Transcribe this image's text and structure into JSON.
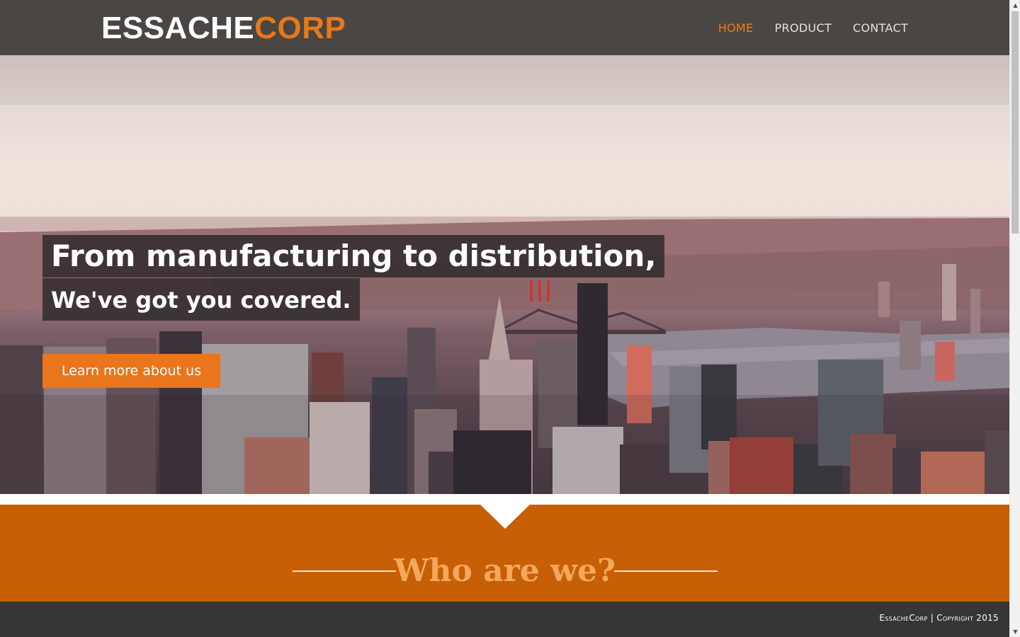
{
  "header": {
    "logo": {
      "part1": "ESSACHE",
      "part2": "CORP"
    },
    "nav": [
      {
        "label": "HOME",
        "active": true
      },
      {
        "label": "PRODUCT",
        "active": false
      },
      {
        "label": "CONTACT",
        "active": false
      }
    ]
  },
  "hero": {
    "headline": "From manufacturing to distribution,",
    "subheadline": "We've got you covered.",
    "cta_label": "Learn more about us"
  },
  "about": {
    "title": "Who are we?"
  },
  "footer": {
    "copyright": "EssacheCorp | Copyright 2015"
  },
  "colors": {
    "header_bg": "#4a4643",
    "accent": "#e9751c",
    "section_bg": "#c75f06",
    "footer_bg": "#383634",
    "section_title": "#f3a85c"
  },
  "icons": {
    "scroll_up": "triangle-up-icon",
    "scroll_down": "triangle-down-icon",
    "section_pointer": "notch-down-icon"
  }
}
